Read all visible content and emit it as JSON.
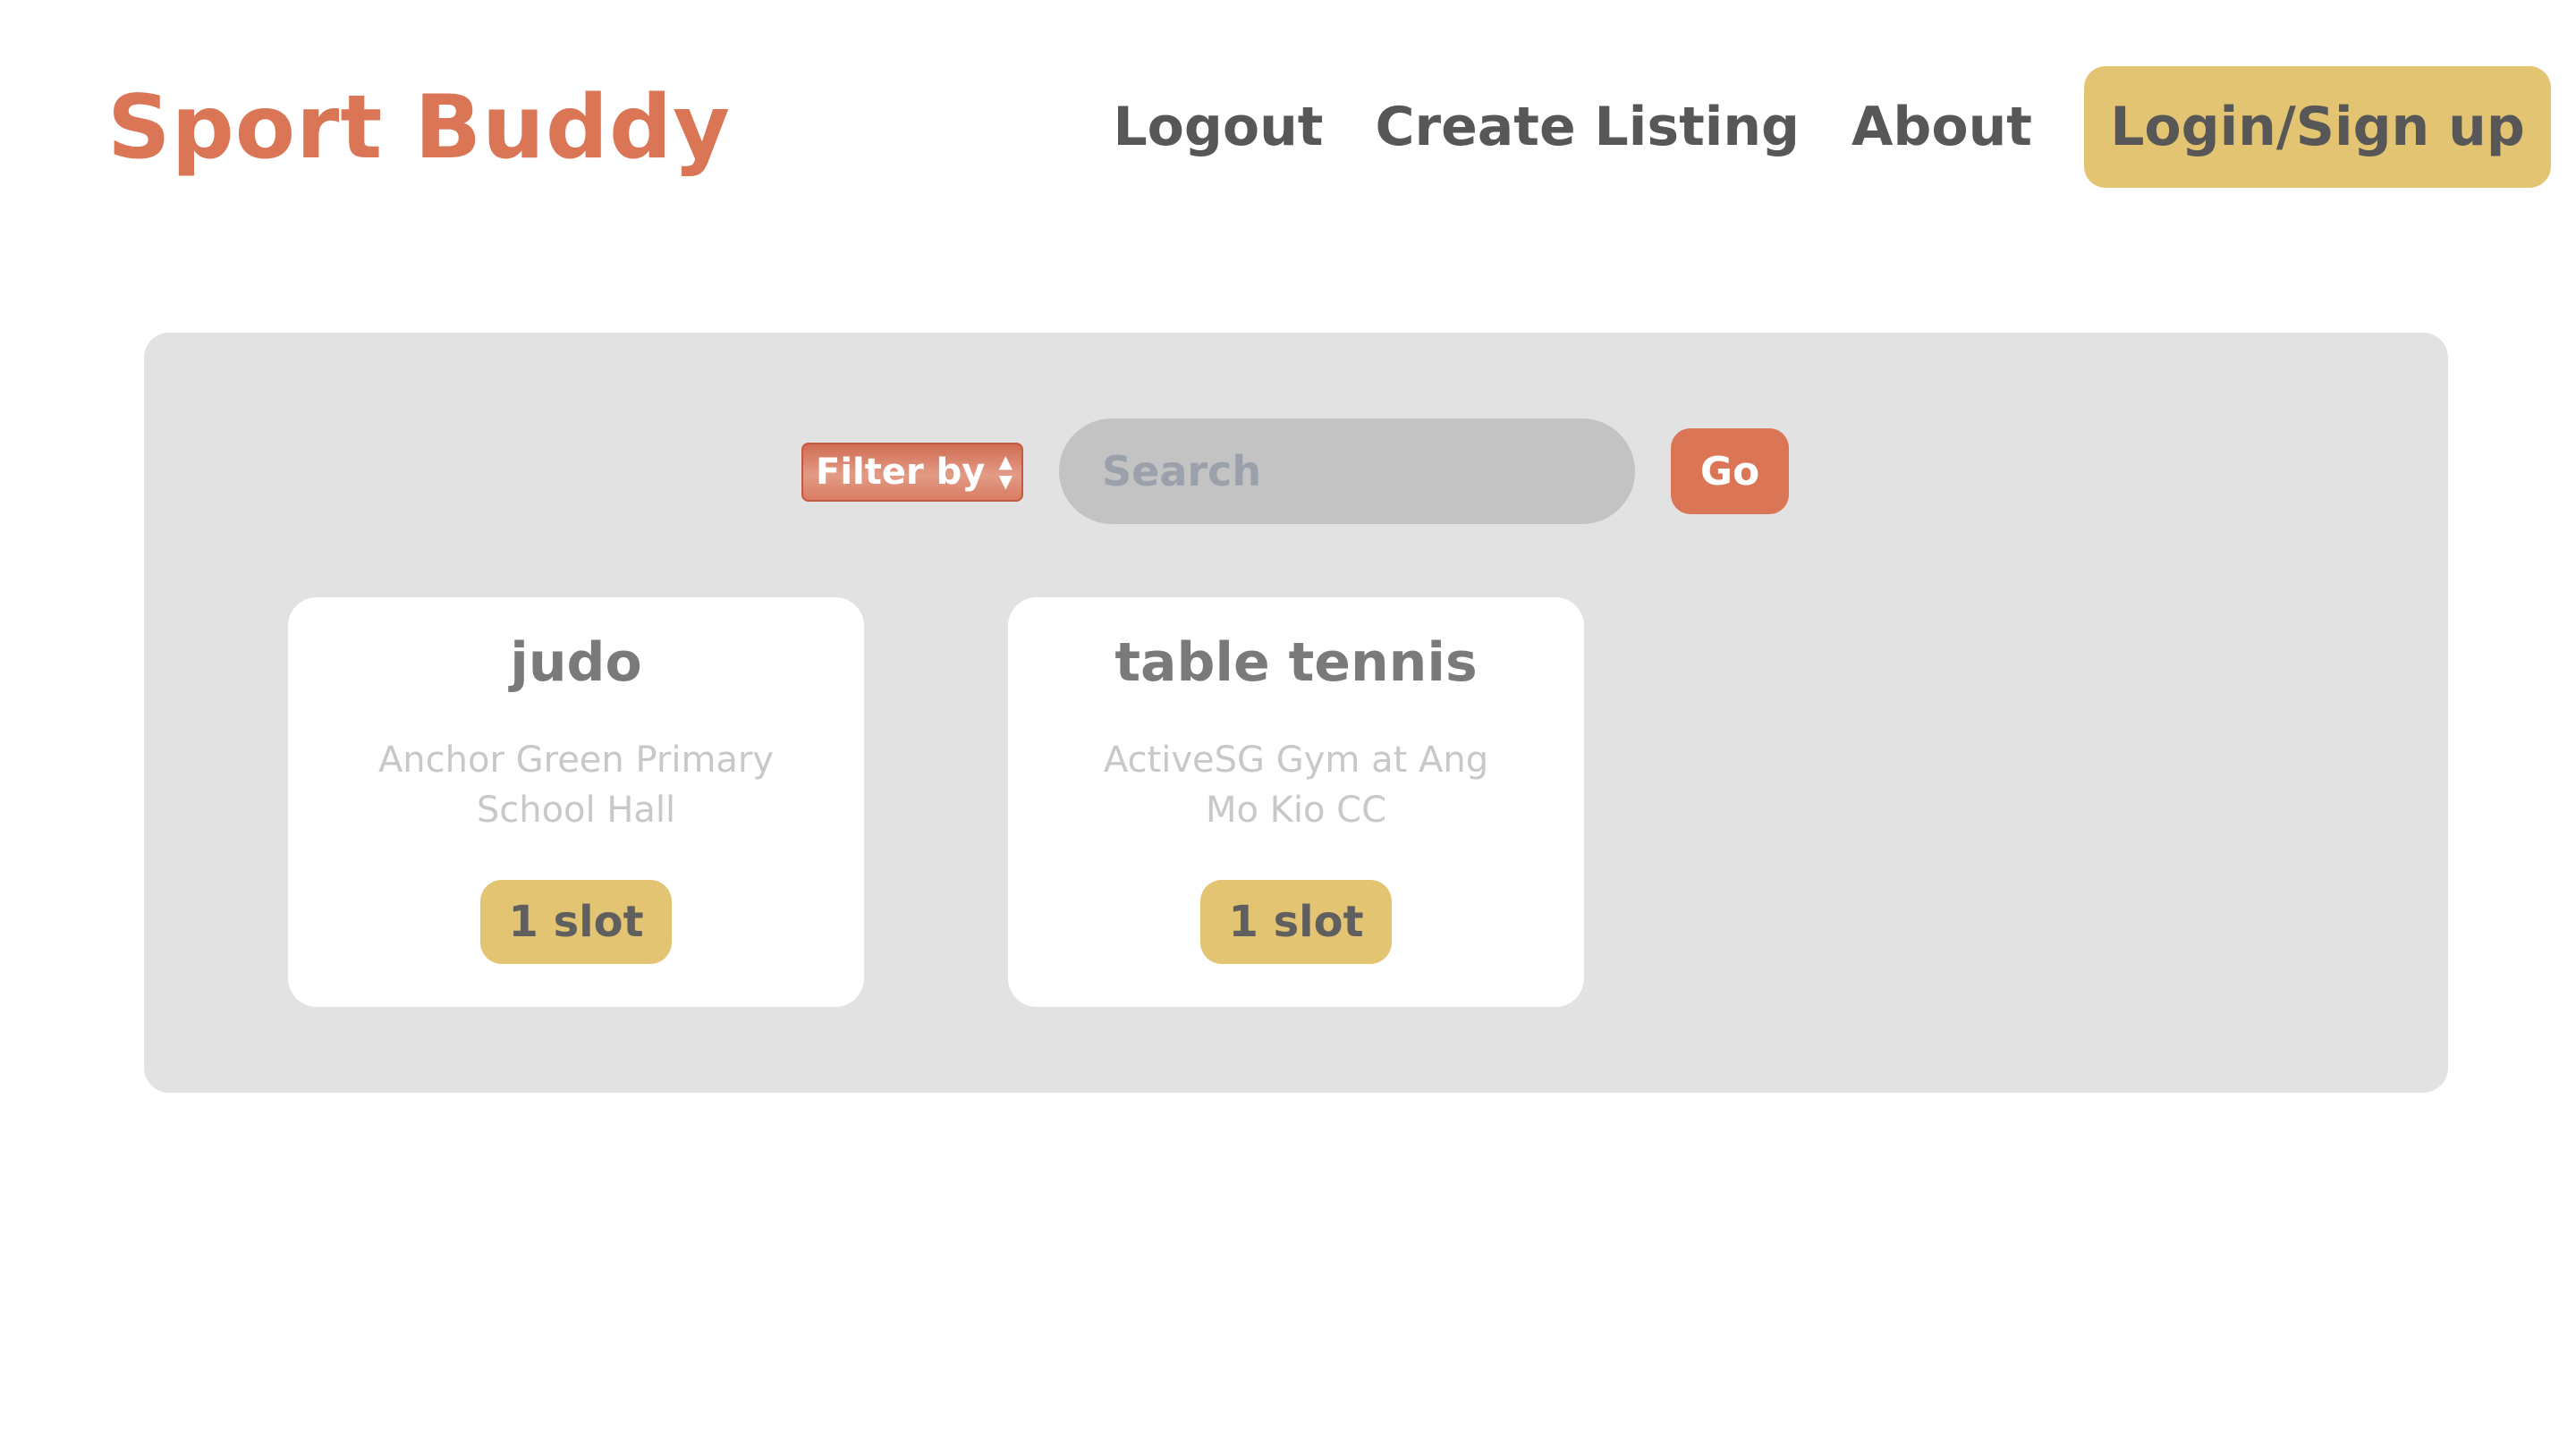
{
  "header": {
    "brand": "Sport Buddy",
    "nav": {
      "logout": "Logout",
      "create_listing": "Create Listing",
      "about": "About",
      "login_signup": "Login/Sign up"
    }
  },
  "search_bar": {
    "filter_label": "Filter by",
    "search_placeholder": "Search",
    "go_label": "Go"
  },
  "listings": [
    {
      "sport": "judo",
      "location": "Anchor Green Primary School Hall",
      "slots": "1 slot"
    },
    {
      "sport": "table tennis",
      "location": "ActiveSG Gym at Ang Mo Kio CC",
      "slots": "1 slot"
    }
  ],
  "colors": {
    "brand": "#da7556",
    "accent": "#e3c472",
    "panel": "#e2e2e2",
    "nav_text": "#575757"
  }
}
